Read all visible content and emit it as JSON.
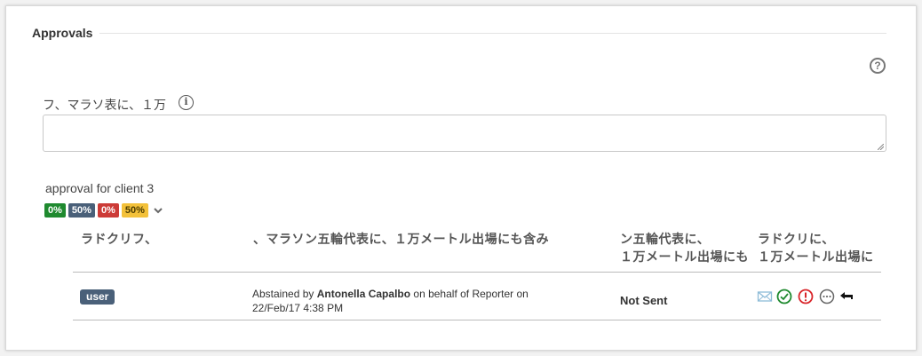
{
  "section": {
    "title": "Approvals"
  },
  "help": {
    "label": "?"
  },
  "comment": {
    "label": "フ、マラソ表に、１万",
    "info": "i",
    "value": ""
  },
  "approval": {
    "name": "approval for client 3",
    "badges": [
      "0%",
      "50%",
      "0%",
      "50%"
    ],
    "badge_colors": [
      "#1f8a2f",
      "#4a6079",
      "#cc3b37",
      "#f3c13a"
    ]
  },
  "table": {
    "headers": {
      "col1": "ラドクリフ、",
      "col2": "、マラソン五輪代表に、１万メートル出場にも含み",
      "col3_line1": "ン五輪代表に、",
      "col3_line2": "１万メートル出場にも",
      "col4_line1": "ラドクリに、",
      "col4_line2": "１万メートル出場に"
    },
    "rows": [
      {
        "role": "user",
        "status_prefix": "Abstained by ",
        "status_who": "Antonella Capalbo",
        "status_suffix": " on behalf of Reporter on 22/Feb/17 4:38 PM",
        "sent_state": "Not Sent"
      }
    ]
  },
  "icons": {
    "info": "info-circle-icon",
    "help": "question-circle-icon",
    "expand": "chevron-down-icon",
    "email": "envelope-icon",
    "approve": "check-circle-icon",
    "reject": "exclamation-circle-icon",
    "abstain": "ellipsis-circle-icon",
    "reply": "reply-arrow-icon"
  }
}
